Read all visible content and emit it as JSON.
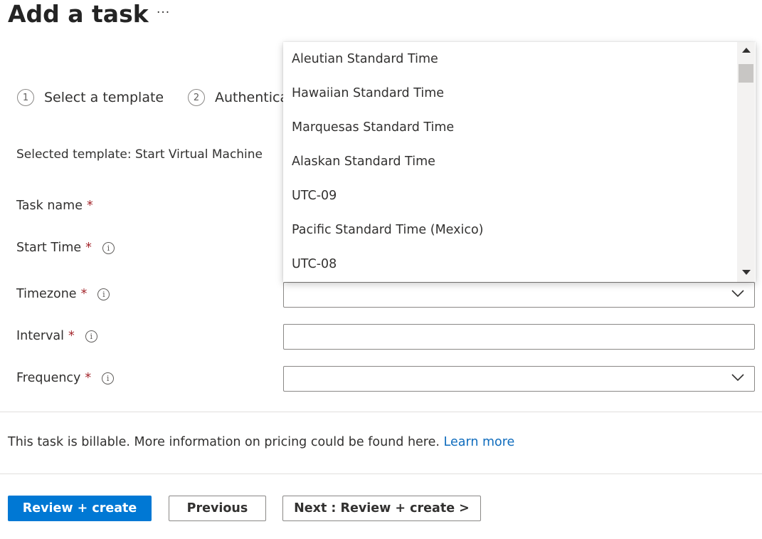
{
  "header": {
    "title": "Add a task",
    "more_label": "···"
  },
  "steps": [
    {
      "number": "1",
      "label": "Select a template"
    },
    {
      "number": "2",
      "label": "Authentica"
    }
  ],
  "selected_template": "Selected template: Start Virtual Machine",
  "form": {
    "task_name_label": "Task name",
    "start_time_label": "Start Time",
    "timezone_label": "Timezone",
    "interval_label": "Interval",
    "frequency_label": "Frequency",
    "required_marker": "*",
    "info_glyph": "i",
    "interval_value": "",
    "timezone_value": "",
    "frequency_value": ""
  },
  "timezone_dropdown": {
    "options": [
      "Aleutian Standard Time",
      "Hawaiian Standard Time",
      "Marquesas Standard Time",
      "Alaskan Standard Time",
      "UTC-09",
      "Pacific Standard Time (Mexico)",
      "UTC-08"
    ],
    "scroll_position": 0.05
  },
  "billing": {
    "text": "This task is billable. More information on pricing could be found here.",
    "link_label": "Learn more"
  },
  "footer": {
    "review_create_label": "Review + create",
    "previous_label": "Previous",
    "next_label": "Next : Review + create >"
  },
  "colors": {
    "primary": "#0078d4",
    "link": "#0f6cbd",
    "required": "#a4262c",
    "border": "#8a8886"
  },
  "icons": {
    "more": "more-icon",
    "info": "info-icon",
    "chevron": "chevron-down-icon",
    "scroll_up": "scroll-up-icon",
    "scroll_down": "scroll-down-icon"
  }
}
